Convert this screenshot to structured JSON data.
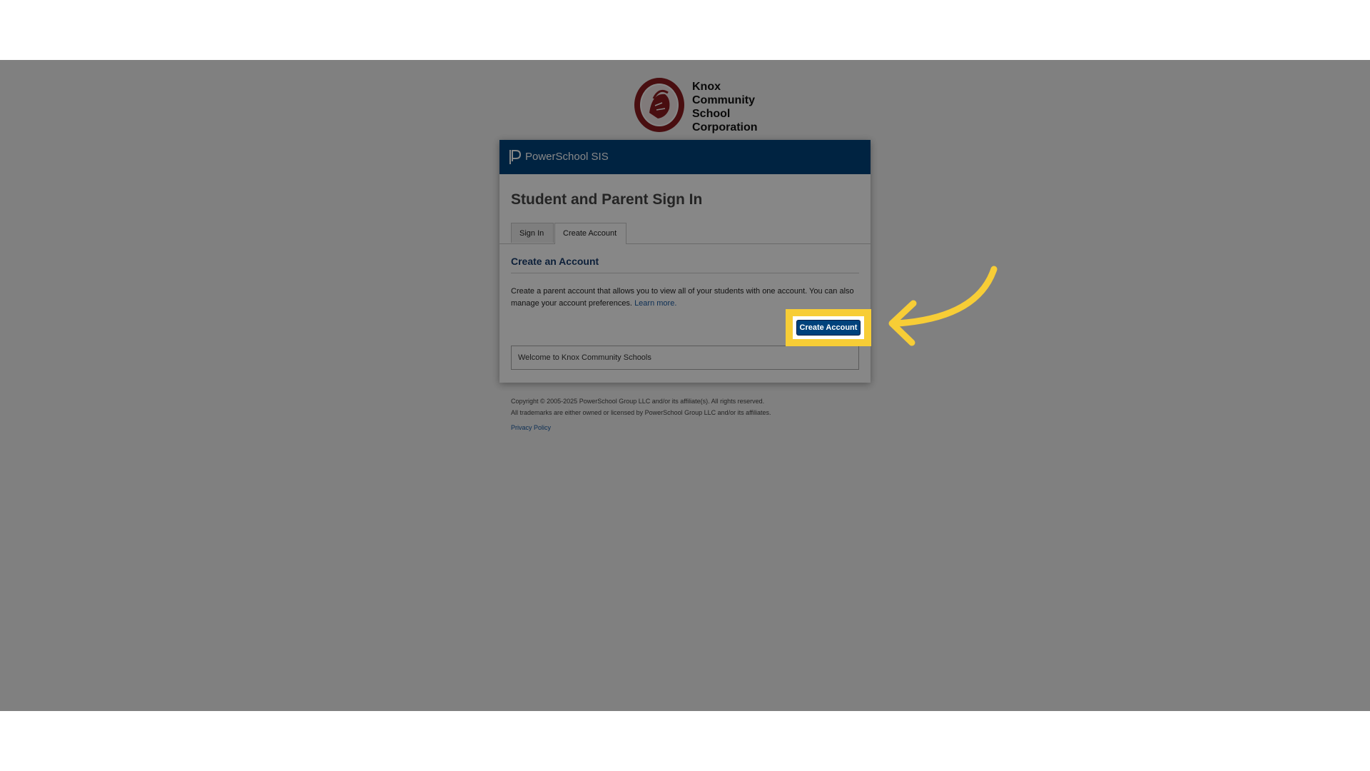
{
  "district": {
    "name_lines": [
      "Knox",
      "Community",
      "School",
      "Corporation"
    ],
    "seal_icon": "district-seal-icon"
  },
  "header": {
    "app_title": "PowerSchool SIS",
    "logo_icon": "powerschool-logo-icon",
    "brand_color": "#00427c"
  },
  "page": {
    "title": "Student and Parent Sign In"
  },
  "tabs": [
    {
      "label": "Sign In",
      "active": false
    },
    {
      "label": "Create Account",
      "active": true
    }
  ],
  "create_section": {
    "title": "Create an Account",
    "description": "Create a parent account that allows you to view all of your students with one account. You can also manage your account preferences.",
    "learn_more": "Learn more.",
    "button_label": "Create Account"
  },
  "welcome_message": "Welcome to Knox Community Schools",
  "footer": {
    "copyright": "Copyright © 2005-2025 PowerSchool Group LLC and/or its affiliate(s). All rights reserved.",
    "trademarks": "All trademarks are either owned or licensed by PowerSchool Group LLC and/or its affiliates.",
    "privacy_link": "Privacy Policy"
  },
  "annotation": {
    "highlight_color": "#f7cd36",
    "arrow_icon": "callout-arrow-icon"
  }
}
